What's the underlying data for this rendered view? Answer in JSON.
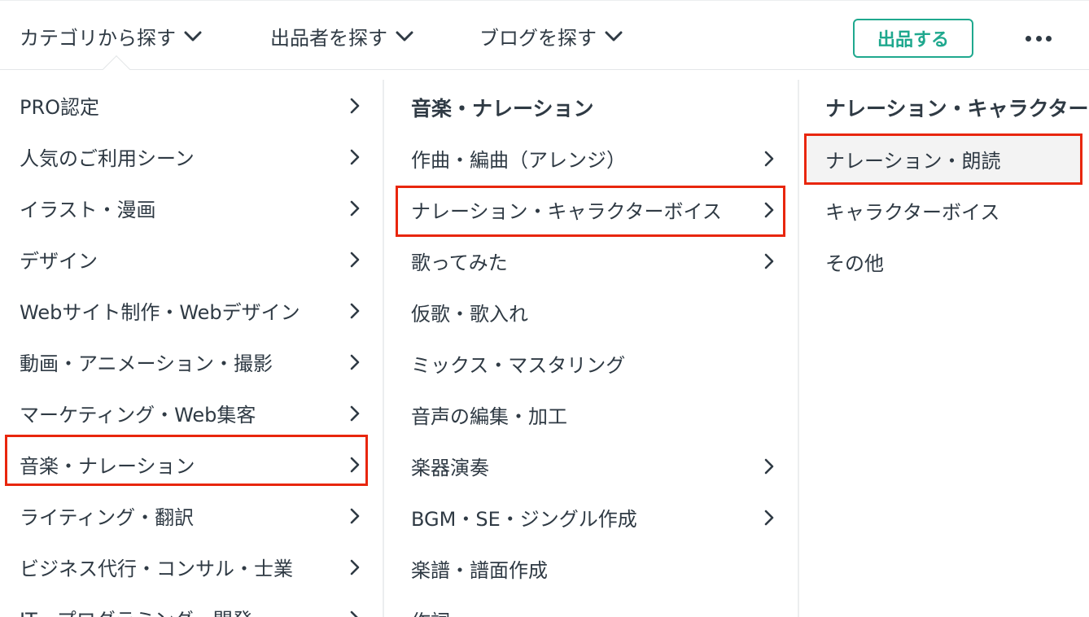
{
  "nav": {
    "category": "カテゴリから探す",
    "seller": "出品者を探す",
    "blog": "ブログを探す",
    "sell_button": "出品する",
    "more_icon": "more-horizontal-icon"
  },
  "col1": {
    "items": [
      {
        "label": "PRO認定"
      },
      {
        "label": "人気のご利用シーン"
      },
      {
        "label": "イラスト・漫画"
      },
      {
        "label": "デザイン"
      },
      {
        "label": "Webサイト制作・Webデザイン"
      },
      {
        "label": "動画・アニメーション・撮影"
      },
      {
        "label": "マーケティング・Web集客"
      },
      {
        "label": "音楽・ナレーション"
      },
      {
        "label": "ライティング・翻訳"
      },
      {
        "label": "ビジネス代行・コンサル・士業"
      },
      {
        "label": "IT・プログラミング・開発"
      }
    ]
  },
  "col2": {
    "heading": "音楽・ナレーション",
    "items": [
      {
        "label": "作曲・編曲（アレンジ）"
      },
      {
        "label": "ナレーション・キャラクターボイス"
      },
      {
        "label": "歌ってみた"
      },
      {
        "label": "仮歌・歌入れ"
      },
      {
        "label": "ミックス・マスタリング"
      },
      {
        "label": "音声の編集・加工"
      },
      {
        "label": "楽器演奏"
      },
      {
        "label": "BGM・SE・ジングル作成"
      },
      {
        "label": "楽譜・譜面作成"
      },
      {
        "label": "作詞"
      }
    ]
  },
  "col3": {
    "heading": "ナレーション・キャラクターボイス",
    "items": [
      {
        "label": "ナレーション・朗読"
      },
      {
        "label": "キャラクターボイス"
      },
      {
        "label": "その他"
      }
    ]
  },
  "colors": {
    "accent": "#1fa88e",
    "highlight": "#e8260d",
    "text": "#2f3a44"
  }
}
